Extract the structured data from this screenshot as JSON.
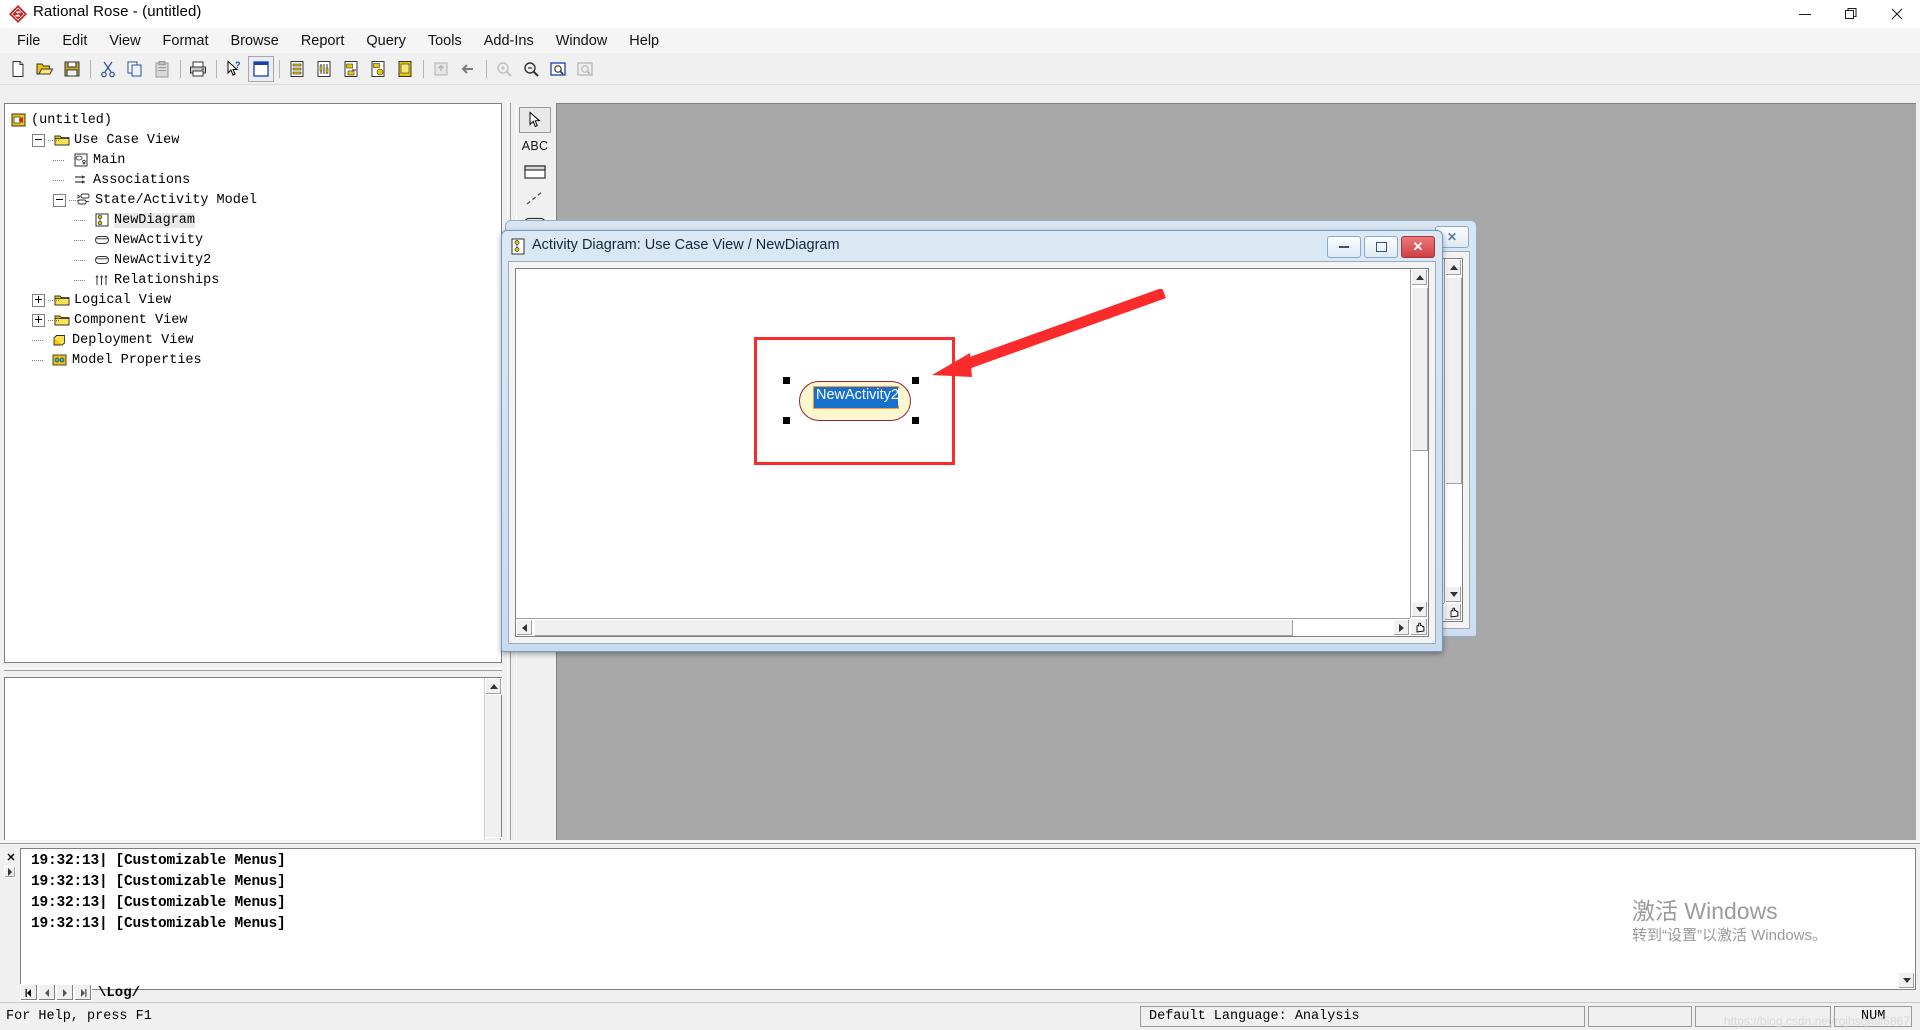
{
  "window": {
    "title": "Rational Rose - (untitled)",
    "icon": "rational-rose-logo",
    "minimize": "—",
    "maximize": "❐",
    "close": "✕"
  },
  "menubar": {
    "items": [
      {
        "label": "File"
      },
      {
        "label": "Edit"
      },
      {
        "label": "View"
      },
      {
        "label": "Format"
      },
      {
        "label": "Browse"
      },
      {
        "label": "Report"
      },
      {
        "label": "Query"
      },
      {
        "label": "Tools"
      },
      {
        "label": "Add-Ins"
      },
      {
        "label": "Window"
      },
      {
        "label": "Help"
      }
    ]
  },
  "toolbar": {
    "buttons": [
      {
        "name": "new-icon"
      },
      {
        "name": "open-icon"
      },
      {
        "name": "save-icon"
      },
      {
        "name": "cut-icon"
      },
      {
        "name": "copy-icon"
      },
      {
        "name": "paste-icon"
      },
      {
        "name": "print-icon"
      },
      {
        "name": "context-help-icon"
      },
      {
        "name": "browse-class-icon"
      },
      {
        "name": "browse-use-case-diagram-icon"
      },
      {
        "name": "browse-sequence-diagram-icon"
      },
      {
        "name": "browse-collaboration-diagram-icon"
      },
      {
        "name": "browse-state-machine-diagram-icon"
      },
      {
        "name": "browse-component-diagram-icon"
      },
      {
        "name": "browse-parent-icon"
      },
      {
        "name": "browse-previous-icon"
      },
      {
        "name": "zoom-in-icon"
      },
      {
        "name": "zoom-out-icon"
      },
      {
        "name": "fit-in-window-icon"
      },
      {
        "name": "undo-fit-icon"
      }
    ]
  },
  "browser": {
    "tree": [
      {
        "label": "(untitled)",
        "depth": 0,
        "icon": "model-icon",
        "expander": "none",
        "selected": false
      },
      {
        "label": "Use Case View",
        "depth": 1,
        "icon": "folder-icon",
        "expander": "minus",
        "selected": false
      },
      {
        "label": "Main",
        "depth": 2,
        "icon": "use-case-diagram-icon",
        "expander": "leaf",
        "selected": false
      },
      {
        "label": "Associations",
        "depth": 2,
        "icon": "associations-icon",
        "expander": "leaf",
        "selected": false
      },
      {
        "label": "State/Activity Model",
        "depth": 2,
        "icon": "state-activity-model-icon",
        "expander": "minus",
        "selected": false
      },
      {
        "label": "NewDiagram",
        "depth": 3,
        "icon": "activity-diagram-icon",
        "expander": "leaf",
        "selected": true
      },
      {
        "label": "NewActivity",
        "depth": 3,
        "icon": "activity-icon",
        "expander": "leaf",
        "selected": false
      },
      {
        "label": "NewActivity2",
        "depth": 3,
        "icon": "activity-icon",
        "expander": "leaf",
        "selected": false
      },
      {
        "label": "Relationships",
        "depth": 3,
        "icon": "relationships-icon",
        "expander": "leaf",
        "selected": false
      },
      {
        "label": "Logical View",
        "depth": 1,
        "icon": "folder-icon",
        "expander": "plus",
        "selected": false
      },
      {
        "label": "Component View",
        "depth": 1,
        "icon": "folder-icon",
        "expander": "plus",
        "selected": false
      },
      {
        "label": "Deployment View",
        "depth": 1,
        "icon": "deployment-icon",
        "expander": "leaf",
        "selected": false
      },
      {
        "label": "Model Properties",
        "depth": 1,
        "icon": "model-properties-icon",
        "expander": "leaf",
        "selected": false
      }
    ]
  },
  "toolbox": {
    "tools": [
      {
        "name": "selection-arrow-tool",
        "selected": true
      },
      {
        "name": "text-box-tool",
        "selected": false
      },
      {
        "name": "note-tool",
        "selected": false
      },
      {
        "name": "anchor-note-to-item-tool",
        "selected": false
      },
      {
        "name": "state-tool",
        "selected": false
      },
      {
        "name": "activity-tool",
        "selected": false
      },
      {
        "name": "start-state-tool",
        "selected": false
      },
      {
        "name": "end-state-tool",
        "selected": false
      },
      {
        "name": "state-transition-tool",
        "selected": false
      },
      {
        "name": "transition-to-self-tool",
        "selected": false
      },
      {
        "name": "horizontal-synchronization-tool",
        "selected": false
      },
      {
        "name": "vertical-synchronization-tool",
        "selected": false
      },
      {
        "name": "decision-tool",
        "selected": false
      },
      {
        "name": "swimlane-tool",
        "selected": false
      }
    ],
    "label": "ABC"
  },
  "diagram_window": {
    "title": "Activity Diagram: Use Case View / NewDiagram",
    "icon": "activity-diagram-icon",
    "minimize_label": "minimize",
    "restore_label": "restore",
    "close_label": "✕",
    "background_window": {
      "close_label": "✕"
    },
    "node": {
      "name": "NewActivity2",
      "editing": true,
      "fill_color": "#fbf8d0",
      "border_color": "#8d2637",
      "selection_color": "#1570cf"
    },
    "annotation": {
      "name": "red-arrow-annotation",
      "color": "#fb2b2b",
      "highlight_box_color": "#fb2b2b"
    }
  },
  "log": {
    "close_label": "✕",
    "entries": [
      {
        "time": "19:32:13|",
        "message": "[Customizable Menus]"
      },
      {
        "time": "19:32:13|",
        "message": "[Customizable Menus]"
      },
      {
        "time": "19:32:13|",
        "message": "[Customizable Menus]"
      },
      {
        "time": "19:32:13|",
        "message": "[Customizable Menus]"
      }
    ],
    "tab_label": "\\Log/"
  },
  "statusbar": {
    "help_text": "For Help, press F1",
    "language": "Default Language: Analysis",
    "cell3": "",
    "cell4": "",
    "num_indicator": "NUM"
  },
  "watermark": {
    "line1": "激活 Windows",
    "line2": "转到“设置”以激活 Windows。",
    "url": "https://blog.csdn.net/rojhsqmlf6867"
  }
}
